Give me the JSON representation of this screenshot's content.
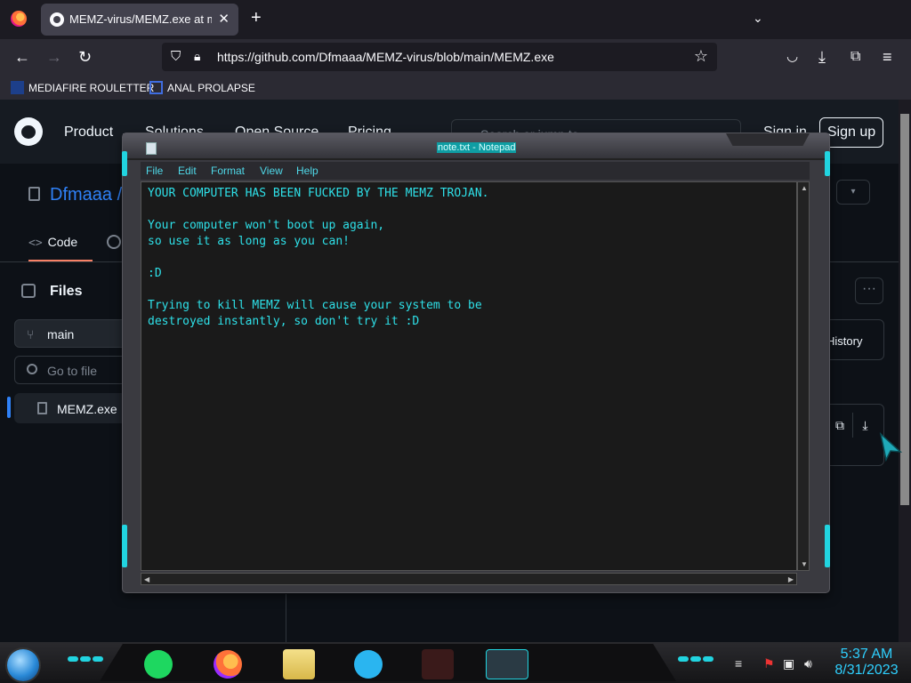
{
  "browser": {
    "tab_title": "MEMZ-virus/MEMZ.exe at main",
    "tab_close": "✕",
    "new_tab": "+",
    "tab_list": "⌄",
    "url": "https://github.com/Dfmaaa/MEMZ-virus/blob/main/MEMZ.exe",
    "bookmarks": [
      {
        "label": "MEDIAFIRE ROULETTER"
      },
      {
        "label": "ANAL PROLAPSE"
      }
    ]
  },
  "github": {
    "nav": [
      "Product",
      "Solutions",
      "Open Source",
      "Pricing"
    ],
    "search_placeholder": "Search or jump to...",
    "sign_in": "Sign in",
    "sign_up": "Sign up",
    "repo_owner": "Dfmaaa /",
    "code_tab": "Code",
    "code_icon": "<>",
    "files_title": "Files",
    "branch": "main",
    "go_to_file": "Go to file",
    "file_name": "MEMZ.exe",
    "history": "History",
    "more": "···"
  },
  "notepad": {
    "title": "note.txt - Notepad",
    "menu": [
      "File",
      "Edit",
      "Format",
      "View",
      "Help"
    ],
    "content": "YOUR COMPUTER HAS BEEN FUCKED BY THE MEMZ TROJAN.\n\nYour computer won't boot up again,\nso use it as long as you can!\n\n:D\n\nTrying to kill MEMZ will cause your system to be\ndestroyed instantly, so don't try it :D"
  },
  "taskbar": {
    "time": "5:37 AM",
    "date": "8/31/2023"
  },
  "colors": {
    "accent_cyan": "#21d4e0",
    "github_bg": "#0d1117",
    "link_blue": "#2f81f7"
  }
}
